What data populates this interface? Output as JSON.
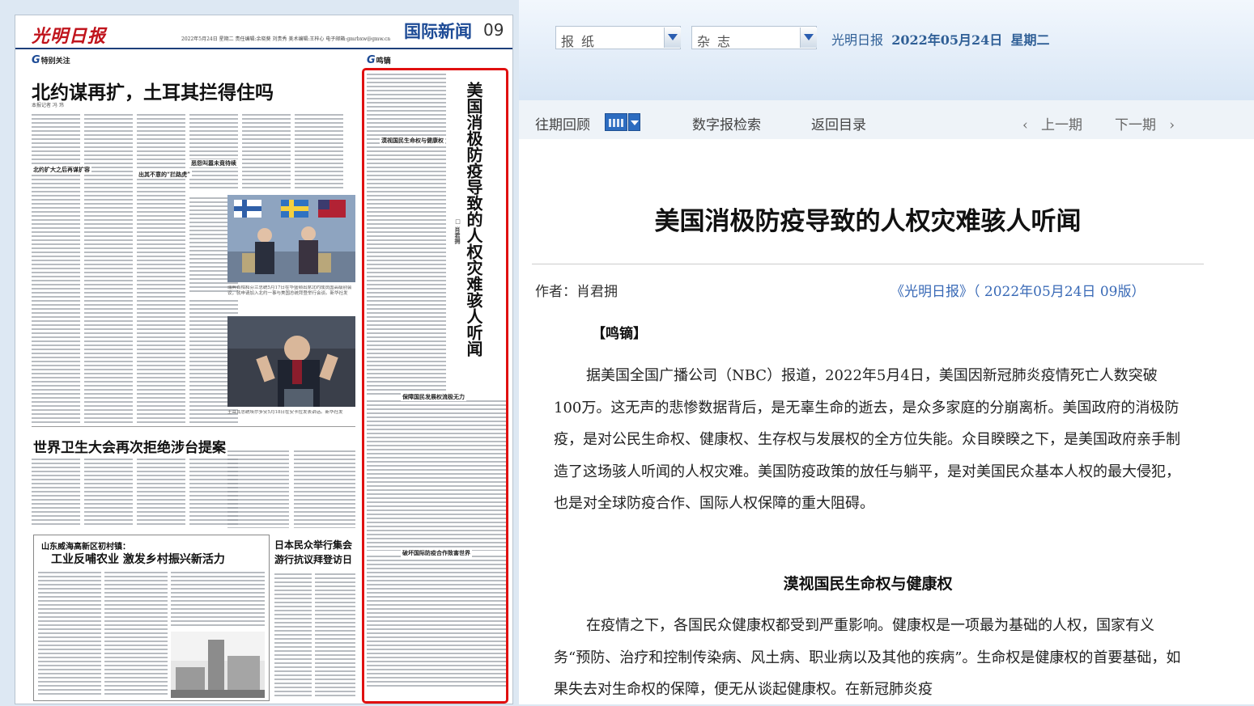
{
  "selectors": {
    "newspaper": "报纸",
    "magazine": "杂志"
  },
  "dateline": {
    "paper": "光明日报",
    "date": "2022年05月24日",
    "weekday": "星期二"
  },
  "nav": {
    "past_review": "往期回顾",
    "digital_search": "数字报检索",
    "back_to_index": "返回目录",
    "prev_issue": "上一期",
    "next_issue": "下一期"
  },
  "article": {
    "title": "美国消极防疫导致的人权灾难骇人听闻",
    "author": "作者：肖君拥",
    "source": "《光明日报》（ 2022年05月24日 09版）",
    "column": "【鸣镝】",
    "paragraphs": [
      "据美国全国广播公司（NBC）报道，2022年5月4日，美国因新冠肺炎疫情死亡人数突破100万。这无声的悲惨数据背后，是无辜生命的逝去，是众多家庭的分崩离析。美国政府的消极防疫，是对公民生命权、健康权、生存权与发展权的全方位失能。众目睽睽之下，是美国政府亲手制造了这场骇人听闻的人权灾难。美国防疫政策的放任与躺平，是对美国民众基本人权的最大侵犯，也是对全球防疫合作、国际人权保障的重大阻碍。",
      "在疫情之下，各国民众健康权都受到严重影响。健康权是一项最为基础的人权，国家有义务“预防、治疗和控制传染病、风土病、职业病以及其他的疾病”。生命权是健康权的首要基础，如果失去对生命权的保障，便无从谈起健康权。在新冠肺炎疫"
    ],
    "subheading": "漠视国民生命权与健康权"
  },
  "paper": {
    "logo": "光明日报",
    "masthead_info": "2022年5月24日  星期二   责任编辑:余晓葵 刘贵秀   美术编辑:王梓心   电子邮箱:gmrbxw@gmw.cn",
    "section": "国际新闻",
    "page_number": "09",
    "col_special": "特别关注",
    "col_mingdi": "鸣镝",
    "g_mark": "G",
    "headline1": "北约谋再扩，土耳其拦得住吗",
    "byline1": "本报记者  冯 玮",
    "sub1": "北约扩大之后再谋扩容",
    "sub2": "出其不意的“拦路虎”",
    "sub3": "恶怨叫嚣未竟待续",
    "caption1": "瑞典首相和芬兰总统5月17日在华盛顿出席北约成员国高级别会议，就申请加入北约一事与美国总统拜登举行会谈。新华社发",
    "caption2": "土耳其总统埃尔多安5月18日在安卡拉发表讲话。新华社发",
    "vtitle": "美国消极防疫导致的人权灾难骇人听闻",
    "vauthor": "□ 肖君拥",
    "sub_m1": "漠视国民生命权与健康权",
    "sub_m2": "保障国民发展权流极无力",
    "sub_m3": "破坏国际防疫合作致害世界",
    "headline2": "世界卫生大会再次拒绝涉台提案",
    "headline3a": "山东威海高新区初村镇：",
    "headline3b": "工业反哺农业  激发乡村振兴新活力",
    "headline4a": "日本民众举行集会",
    "headline4b": "游行抗议拜登访日"
  }
}
